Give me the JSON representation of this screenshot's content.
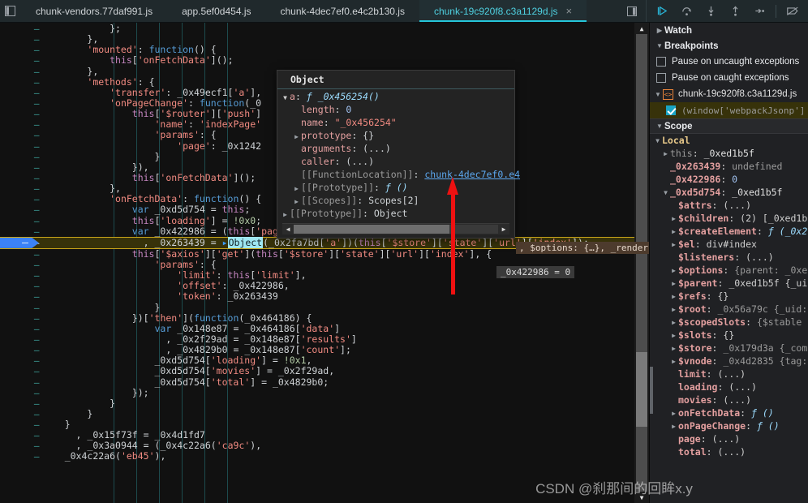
{
  "window": {
    "panel_toggle_icon": "panel-toggle-icon"
  },
  "tabs": {
    "items": [
      {
        "label": "chunk-vendors.77daf991.js",
        "active": false
      },
      {
        "label": "app.5ef0d454.js",
        "active": false
      },
      {
        "label": "chunk-4dec7ef0.e4c2b130.js",
        "active": false
      },
      {
        "label": "chunk-19c920f8.c3a1129d.js",
        "active": true
      }
    ],
    "close_glyph": "×",
    "more_icon": "more-tabs-icon"
  },
  "debug_controls": [
    {
      "name": "resume-script-execution",
      "icon": "resume-icon"
    },
    {
      "name": "step-over-next-function-call",
      "icon": "step-over-icon"
    },
    {
      "name": "step-into-next-function-call",
      "icon": "step-into-icon"
    },
    {
      "name": "step-out-of-current-function",
      "icon": "step-out-icon"
    },
    {
      "name": "step",
      "icon": "step-icon"
    },
    {
      "name": "deactivate-breakpoints",
      "icon": "deactivate-breakpoints-icon"
    }
  ],
  "editor": {
    "lines": [
      "            };",
      "        },",
      "        'mounted': function() {",
      "            this['onFetchData']();",
      "        },",
      "        'methods': {",
      "            'transfer': _0x49ecf1['a'],",
      "            'onPageChange': function(_0",
      "                this['$router']['push']",
      "                    'name': 'indexPage'",
      "                    'params': {",
      "                        'page': _0x1242",
      "                    }",
      "                }),",
      "                this['onFetchData']();",
      "            },",
      "            'onFetchData': function() {",
      "                var _0xd5d754 = this;",
      "                this['loading'] = !0x0;",
      "                var _0x422986 = (this['page'] - 0x1) * this['limit']",
      "                  , _0x263439 = Object(_0x2fa7bd['a'])(this['$store']['state']['url']['index']);",
      "                this['$axios']['get'](this['$store']['state']['url']['index'], {",
      "                    'params': {",
      "                        'limit': this['limit'],",
      "                        'offset': _0x422986,",
      "                        'token': _0x263439",
      "                    }",
      "                })['then'](function(_0x464186) {",
      "                    var _0x148e87 = _0x464186['data']",
      "                      , _0x2f29ad = _0x148e87['results']",
      "                      , _0x4829b0 = _0x148e87['count'];",
      "                    _0xd5d754['loading'] = !0x1,",
      "                    _0xd5d754['movies'] = _0x2f29ad,",
      "                    _0xd5d754['total'] = _0x4829b0;",
      "                });",
      "            }",
      "        }",
      "    }",
      "      , _0x15f73f = _0x4d1fd7",
      "      , _0x3a0944 = (_0x4c22a6('ca9c'),",
      "    _0x4c22a6('eb45'),"
    ],
    "current_line_index": 20,
    "eval_chip_1": ", $options: {…}, _render",
    "eval_chip_2": "_0x422986 = 0"
  },
  "object_popup": {
    "title": "Object",
    "rows": [
      {
        "indent": 0,
        "twisty": "open",
        "name": "a",
        "sep": ":",
        "value": "ƒ _0x456254()",
        "kind": "fn"
      },
      {
        "indent": 1,
        "twisty": "",
        "name": "length",
        "sep": ":",
        "value": "0",
        "kind": "num"
      },
      {
        "indent": 1,
        "twisty": "",
        "name": "name",
        "sep": ":",
        "value": "\"_0x456254\"",
        "kind": "str"
      },
      {
        "indent": 1,
        "twisty": "closed",
        "name": "prototype",
        "sep": ":",
        "value": "{}",
        "kind": "plain"
      },
      {
        "indent": 1,
        "twisty": "",
        "name": "arguments",
        "sep": ":",
        "value": "(...)",
        "kind": "plain"
      },
      {
        "indent": 1,
        "twisty": "",
        "name": "caller",
        "sep": ":",
        "value": "(...)",
        "kind": "plain"
      },
      {
        "indent": 1,
        "twisty": "",
        "name": "[[FunctionLocation]]",
        "sep": ":",
        "value": "chunk-4dec7ef0.e4",
        "kind": "link",
        "internal": true
      },
      {
        "indent": 1,
        "twisty": "closed",
        "name": "[[Prototype]]",
        "sep": ":",
        "value": "ƒ ()",
        "kind": "fn",
        "internal": true
      },
      {
        "indent": 1,
        "twisty": "closed",
        "name": "[[Scopes]]",
        "sep": ":",
        "value": "Scopes[2]",
        "kind": "plain",
        "internal": true
      },
      {
        "indent": 0,
        "twisty": "closed",
        "name": "[[Prototype]]",
        "sep": ":",
        "value": "Object",
        "kind": "plain",
        "internal": true
      }
    ]
  },
  "sidebar": {
    "watch": {
      "label": "Watch",
      "caret": "closed"
    },
    "breakpoints": {
      "label": "Breakpoints",
      "caret": "open"
    },
    "pause_uncaught": {
      "label": "Pause on uncaught exceptions",
      "checked": false
    },
    "pause_caught": {
      "label": "Pause on caught exceptions",
      "checked": false
    },
    "breakpoint_file": {
      "label": "chunk-19c920f8.c3a1129d.js",
      "icon": "source-file-icon"
    },
    "breakpoint_entry": {
      "label": "(window['webpackJsonp']",
      "checked": true
    },
    "scope": {
      "label": "Scope",
      "caret": "open"
    },
    "local": {
      "label": "Local",
      "caret": "open"
    },
    "locals": [
      {
        "indent": 1,
        "twisty": "closed",
        "name": "this",
        "name_style": "dim",
        "value": "_0xed1b5f",
        "value_style": "id"
      },
      {
        "indent": 1,
        "twisty": "",
        "name": "_0x263439",
        "name_style": "normal",
        "value": "undefined",
        "value_style": "dim"
      },
      {
        "indent": 1,
        "twisty": "",
        "name": "_0x422986",
        "name_style": "normal",
        "value": "0",
        "value_style": "num"
      },
      {
        "indent": 1,
        "twisty": "open",
        "name": "_0xd5d754",
        "name_style": "normal",
        "value": "_0xed1b5f",
        "value_style": "id"
      },
      {
        "indent": 2,
        "twisty": "",
        "name": "$attrs",
        "name_style": "normal",
        "value": "(...)",
        "value_style": "plain"
      },
      {
        "indent": 2,
        "twisty": "closed",
        "name": "$children",
        "name_style": "normal",
        "value": "(2) [_0xed1b",
        "value_style": "plain"
      },
      {
        "indent": 2,
        "twisty": "closed",
        "name": "$createElement",
        "name_style": "normal",
        "value": "ƒ (_0x2",
        "value_style": "fn"
      },
      {
        "indent": 2,
        "twisty": "closed",
        "name": "$el",
        "name_style": "normal",
        "value": "div#index",
        "value_style": "plain"
      },
      {
        "indent": 2,
        "twisty": "",
        "name": "$listeners",
        "name_style": "normal",
        "value": "(...)",
        "value_style": "plain"
      },
      {
        "indent": 2,
        "twisty": "closed",
        "name": "$options",
        "name_style": "normal",
        "value": "{parent: _0xe",
        "value_style": "dim"
      },
      {
        "indent": 2,
        "twisty": "closed",
        "name": "$parent",
        "name_style": "normal",
        "value": "_0xed1b5f {_ui",
        "value_style": "plain"
      },
      {
        "indent": 2,
        "twisty": "closed",
        "name": "$refs",
        "name_style": "normal",
        "value": "{}",
        "value_style": "plain"
      },
      {
        "indent": 2,
        "twisty": "closed",
        "name": "$root",
        "name_style": "normal",
        "value": "_0x56a79c {_uid:",
        "value_style": "dim"
      },
      {
        "indent": 2,
        "twisty": "closed",
        "name": "$scopedSlots",
        "name_style": "normal",
        "value": "{$stable",
        "value_style": "dim"
      },
      {
        "indent": 2,
        "twisty": "closed",
        "name": "$slots",
        "name_style": "normal",
        "value": "{}",
        "value_style": "plain"
      },
      {
        "indent": 2,
        "twisty": "closed",
        "name": "$store",
        "name_style": "normal",
        "value": "_0x179d3a {_com",
        "value_style": "dim"
      },
      {
        "indent": 2,
        "twisty": "closed",
        "name": "$vnode",
        "name_style": "normal",
        "value": "_0x4d2835 {tag:",
        "value_style": "dim"
      },
      {
        "indent": 2,
        "twisty": "",
        "name": "limit",
        "name_style": "normal",
        "value": "(...)",
        "value_style": "plain"
      },
      {
        "indent": 2,
        "twisty": "",
        "name": "loading",
        "name_style": "normal",
        "value": "(...)",
        "value_style": "plain"
      },
      {
        "indent": 2,
        "twisty": "",
        "name": "movies",
        "name_style": "normal",
        "value": "(...)",
        "value_style": "plain"
      },
      {
        "indent": 2,
        "twisty": "closed",
        "name": "onFetchData",
        "name_style": "normal",
        "value": "ƒ ()",
        "value_style": "fn"
      },
      {
        "indent": 2,
        "twisty": "closed",
        "name": "onPageChange",
        "name_style": "normal",
        "value": "ƒ ()",
        "value_style": "fn"
      },
      {
        "indent": 2,
        "twisty": "",
        "name": "page",
        "name_style": "normal",
        "value": "(...)",
        "value_style": "plain"
      },
      {
        "indent": 2,
        "twisty": "",
        "name": "total",
        "name_style": "normal",
        "value": "(...)",
        "value_style": "plain"
      }
    ]
  },
  "watermark": "CSDN @刹那间的回眸x.y"
}
